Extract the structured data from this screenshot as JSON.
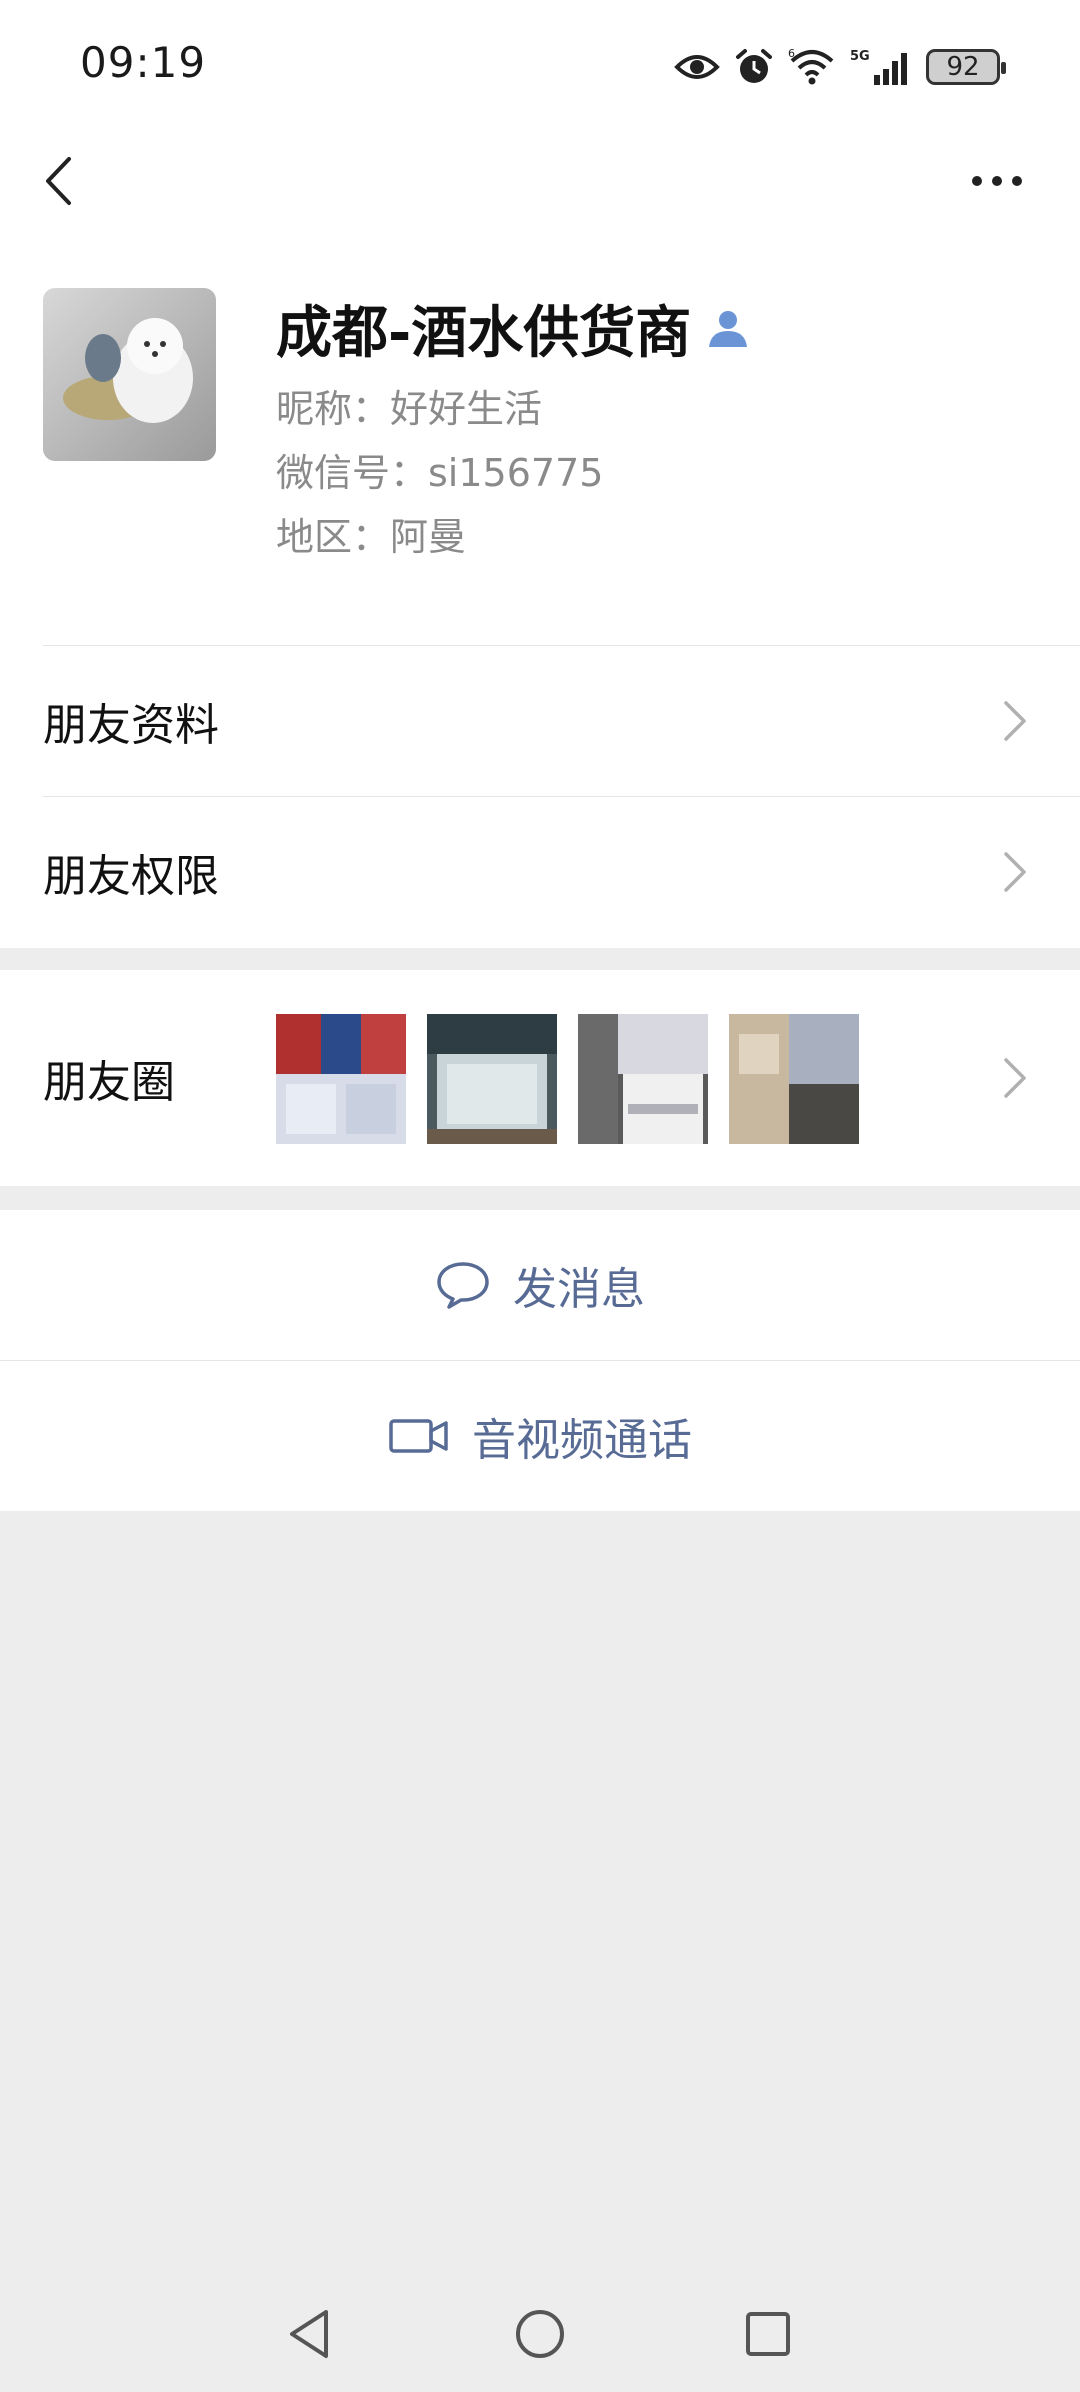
{
  "status_bar": {
    "time": "09:19",
    "battery": "92",
    "icons": [
      "eye-icon",
      "alarm-icon",
      "wifi-icon",
      "5g-signal-icon",
      "battery-icon"
    ]
  },
  "nav": {
    "back_icon": "chevron-left-icon",
    "more_icon": "more-dots-icon"
  },
  "profile": {
    "name": "成都-酒水供货商",
    "nickname": "昵称：好好生活",
    "wechat_id": "微信号：si156775",
    "region": "地区：阿曼",
    "badge_icon": "person-icon"
  },
  "rows": {
    "friend_info": "朋友资料",
    "friend_permissions": "朋友权限",
    "moments": "朋友圈"
  },
  "actions": {
    "send_message": "发消息",
    "video_call": "音视频通话"
  },
  "colors": {
    "link_blue": "#576b95",
    "badge_blue": "#6b94d6",
    "bg_gray": "#ededed"
  }
}
